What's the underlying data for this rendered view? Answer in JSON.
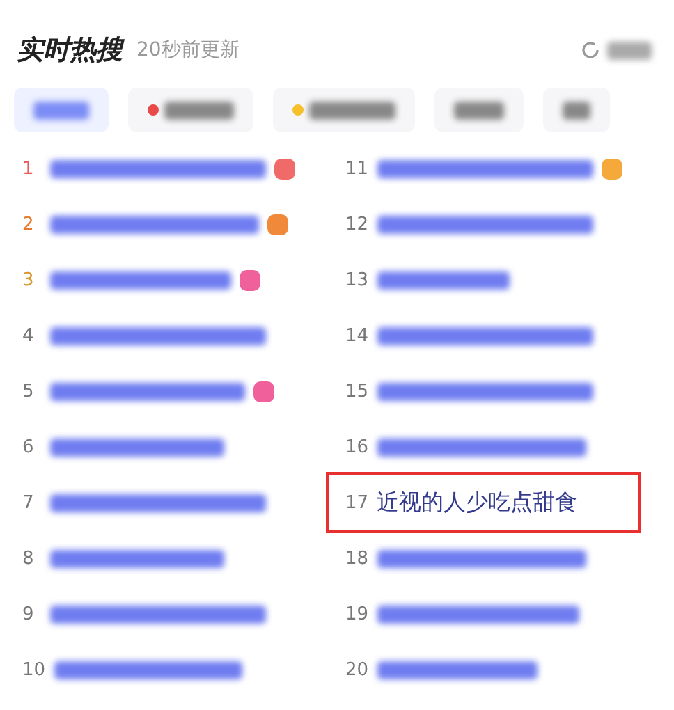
{
  "header": {
    "title": "实时热搜",
    "updated": "20秒前更新"
  },
  "tabs": [
    {
      "selected": true
    },
    {
      "selected": false,
      "color": "#e84a4a"
    },
    {
      "selected": false,
      "color": "#f5c02a"
    },
    {
      "selected": false
    },
    {
      "selected": false
    }
  ],
  "items": [
    {
      "rank": "1",
      "highlighted": false,
      "color": "#f06a6a"
    },
    {
      "rank": "2",
      "highlighted": false,
      "color": "#f08a3a"
    },
    {
      "rank": "3",
      "highlighted": false,
      "color": "#f0609a"
    },
    {
      "rank": "4",
      "highlighted": false
    },
    {
      "rank": "5",
      "highlighted": false,
      "color": "#f0609a"
    },
    {
      "rank": "6",
      "highlighted": false
    },
    {
      "rank": "7",
      "highlighted": false
    },
    {
      "rank": "8",
      "highlighted": false
    },
    {
      "rank": "9",
      "highlighted": false
    },
    {
      "rank": "10",
      "highlighted": false
    },
    {
      "rank": "11",
      "highlighted": false,
      "color": "#f5a93a"
    },
    {
      "rank": "12",
      "highlighted": false
    },
    {
      "rank": "13",
      "highlighted": false
    },
    {
      "rank": "14",
      "highlighted": false
    },
    {
      "rank": "15",
      "highlighted": false
    },
    {
      "rank": "16",
      "highlighted": false
    },
    {
      "rank": "17",
      "title": "近视的人少吃点甜食",
      "highlighted": true
    },
    {
      "rank": "18",
      "highlighted": false
    },
    {
      "rank": "19",
      "highlighted": false
    },
    {
      "rank": "20",
      "highlighted": false
    }
  ]
}
